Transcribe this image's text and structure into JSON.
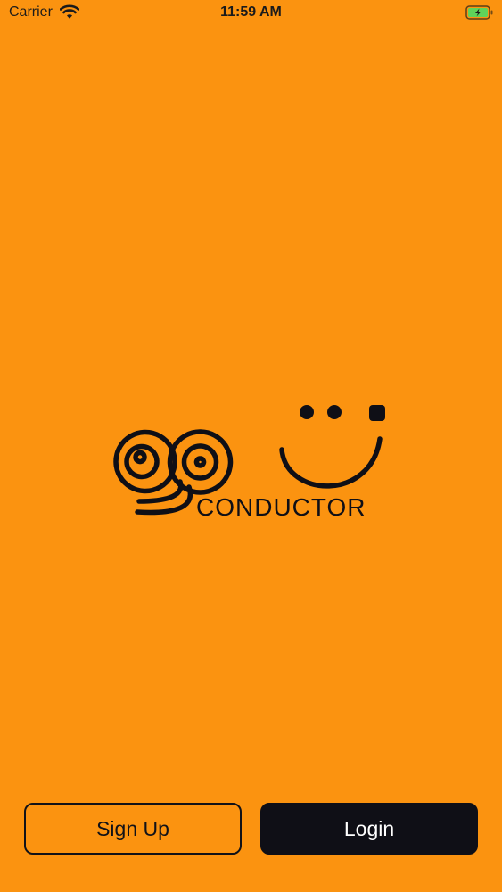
{
  "theme": {
    "background": "#FB9310",
    "logo_color": "#0F0F16",
    "login_button_bg": "#0F0F16",
    "login_button_text": "#FFFFFF",
    "status_text": "#1B1B1B",
    "battery_fill": "#5FD35A"
  },
  "status_bar": {
    "carrier": "Carrier",
    "wifi_icon": "wifi-icon",
    "time": "11:59 AM",
    "battery_icon": "battery-charging-icon"
  },
  "logo": {
    "wordmark": "CONDUCTOR"
  },
  "actions": {
    "signup_label": "Sign Up",
    "login_label": "Login"
  }
}
